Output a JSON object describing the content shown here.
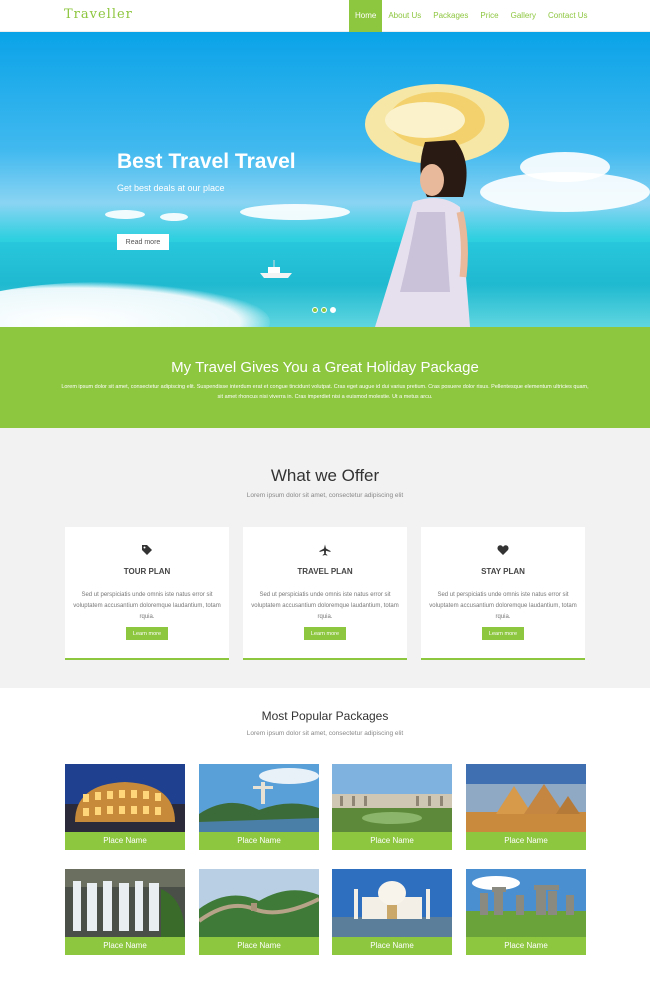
{
  "brand": "Traveller",
  "nav": [
    "Home",
    "About Us",
    "Packages",
    "Price",
    "Gallery",
    "Contact Us"
  ],
  "hero": {
    "title": "Best Travel Travel",
    "subtitle": "Get best deals at our place",
    "button": "Read more",
    "slides": 3,
    "active_slide": 3
  },
  "banner": {
    "title": "My Travel Gives You a Great Holiday Package",
    "text": "Lorem ipsum dolor sit amet, consectetur adipiscing elit. Suspendisse interdum erat et congue tincidunt volutpat. Cras eget augue id dui varius pretium. Cras posuere dolor risus. Pellentesque elementum ultricies quam, sit amet rhoncus nisi viverra in. Cras imperdiet nisi a euismod molestie. Ut a metus arcu."
  },
  "offer": {
    "title": "What we Offer",
    "subtitle": "Lorem ipsum dolor sit amet, consectetur adipiscing elit",
    "cards": [
      {
        "icon": "tag-icon",
        "title": "TOUR PLAN",
        "text": "Sed ut perspiciatis unde omnis iste natus error sit voluptatem accusantium doloremque laudantium, totam rquia.",
        "button": "Learn more"
      },
      {
        "icon": "airplane-icon",
        "title": "TRAVEL PLAN",
        "text": "Sed ut perspiciatis unde omnis iste natus error sit voluptatem accusantium doloremque laudantium, totam rquia.",
        "button": "Learn more"
      },
      {
        "icon": "heart-icon",
        "title": "STAY PLAN",
        "text": "Sed ut perspiciatis unde omnis iste natus error sit voluptatem accusantium doloremque laudantium, totam rquia.",
        "button": "Learn more"
      }
    ]
  },
  "packages": {
    "title": "Most Popular Packages",
    "subtitle": "Lorem ipsum dolor sit amet, consectetur adipiscing elit",
    "items": [
      {
        "label": "Place Name",
        "image": "colosseum"
      },
      {
        "label": "Place Name",
        "image": "christ-the-redeemer"
      },
      {
        "label": "Place Name",
        "image": "palace-gardens"
      },
      {
        "label": "Place Name",
        "image": "pyramids"
      },
      {
        "label": "Place Name",
        "image": "waterfall"
      },
      {
        "label": "Place Name",
        "image": "great-wall"
      },
      {
        "label": "Place Name",
        "image": "taj-mahal"
      },
      {
        "label": "Place Name",
        "image": "stonehenge"
      }
    ]
  },
  "colors": {
    "accent": "#8dc63f",
    "sky": "#0aa3e8",
    "section_bg": "#f2f2f2"
  }
}
